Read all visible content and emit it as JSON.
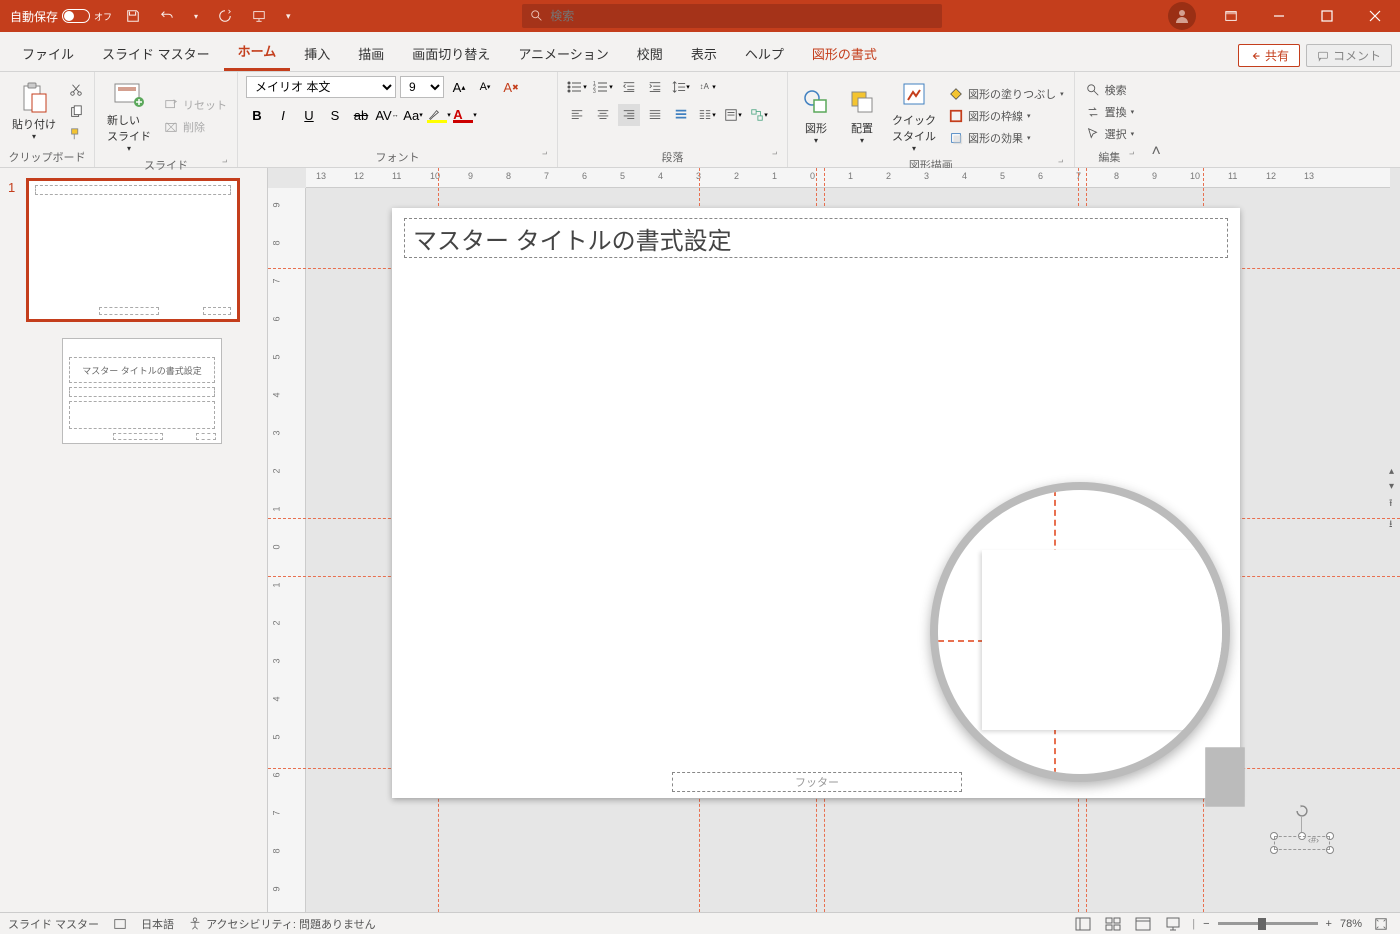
{
  "titlebar": {
    "autosave_label": "自動保存",
    "autosave_state": "オフ",
    "search_placeholder": "検索"
  },
  "tabs": {
    "file": "ファイル",
    "slide_master": "スライド マスター",
    "home": "ホーム",
    "insert": "挿入",
    "draw": "描画",
    "transition": "画面切り替え",
    "animation": "アニメーション",
    "review": "校閲",
    "view": "表示",
    "help": "ヘルプ",
    "shape_format": "図形の書式",
    "share": "共有",
    "comment": "コメント"
  },
  "ribbon": {
    "clipboard": {
      "label": "クリップボード",
      "paste": "貼り付け"
    },
    "slides": {
      "label": "スライド",
      "new_slide": "新しい\nスライド",
      "reset": "リセット",
      "delete": "削除"
    },
    "font": {
      "label": "フォント",
      "name": "メイリオ 本文",
      "size": "9"
    },
    "paragraph": {
      "label": "段落"
    },
    "drawing": {
      "label": "図形描画",
      "shape": "図形",
      "arrange": "配置",
      "quick_style": "クイック\nスタイル",
      "fill": "図形の塗りつぶし",
      "outline": "図形の枠線",
      "effects": "図形の効果"
    },
    "editing": {
      "label": "編集",
      "find": "検索",
      "replace": "置換",
      "select": "選択"
    }
  },
  "canvas": {
    "title_text": "マスター タイトルの書式設定",
    "footer_text": "フッター",
    "hruler_ticks": [
      "13",
      "12",
      "11",
      "10",
      "9",
      "8",
      "7",
      "6",
      "5",
      "4",
      "3",
      "2",
      "1",
      "0",
      "1",
      "2",
      "3",
      "4",
      "5",
      "6",
      "7",
      "8",
      "9",
      "10",
      "11",
      "12",
      "13"
    ],
    "vruler_ticks": [
      "9",
      "8",
      "7",
      "6",
      "5",
      "4",
      "3",
      "2",
      "1",
      "0",
      "1",
      "2",
      "3",
      "4",
      "5",
      "6",
      "7",
      "8",
      "9"
    ]
  },
  "thumbs": {
    "num1": "1",
    "layout_title": "マスター タイトルの書式設定"
  },
  "status": {
    "view_name": "スライド マスター",
    "language": "日本語",
    "accessibility": "アクセシビリティ: 問題ありません",
    "zoom": "78%"
  }
}
